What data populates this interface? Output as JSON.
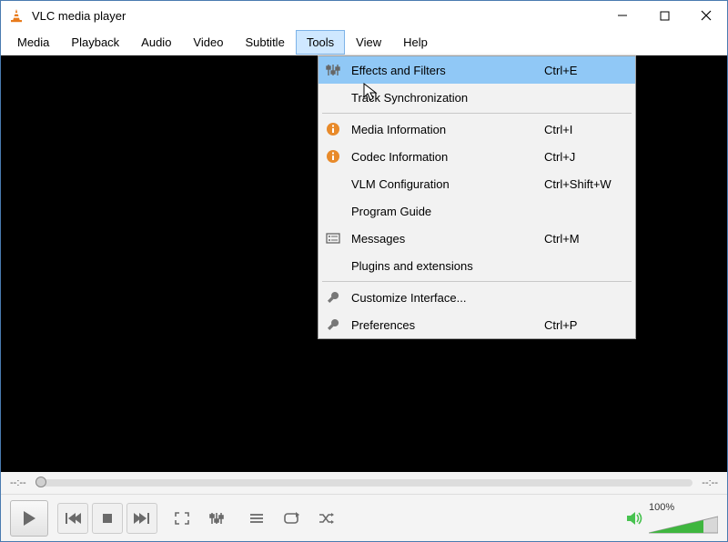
{
  "title": "VLC media player",
  "menubar": [
    "Media",
    "Playback",
    "Audio",
    "Video",
    "Subtitle",
    "Tools",
    "View",
    "Help"
  ],
  "open_menu_index": 5,
  "tools_menu": {
    "groups": [
      [
        {
          "icon": "sliders",
          "label": "Effects and Filters",
          "shortcut": "Ctrl+E",
          "selected": true
        },
        {
          "icon": "",
          "label": "Track Synchronization",
          "shortcut": ""
        }
      ],
      [
        {
          "icon": "info",
          "label": "Media Information",
          "shortcut": "Ctrl+I"
        },
        {
          "icon": "info",
          "label": "Codec Information",
          "shortcut": "Ctrl+J"
        },
        {
          "icon": "",
          "label": "VLM Configuration",
          "shortcut": "Ctrl+Shift+W"
        },
        {
          "icon": "",
          "label": "Program Guide",
          "shortcut": ""
        },
        {
          "icon": "messages",
          "label": "Messages",
          "shortcut": "Ctrl+M"
        },
        {
          "icon": "",
          "label": "Plugins and extensions",
          "shortcut": ""
        }
      ],
      [
        {
          "icon": "wrench",
          "label": "Customize Interface...",
          "shortcut": ""
        },
        {
          "icon": "wrench",
          "label": "Preferences",
          "shortcut": "Ctrl+P"
        }
      ]
    ]
  },
  "time": {
    "elapsed": "--:--",
    "remaining": "--:--"
  },
  "volume": {
    "percent_label": "100%",
    "value": 100
  }
}
